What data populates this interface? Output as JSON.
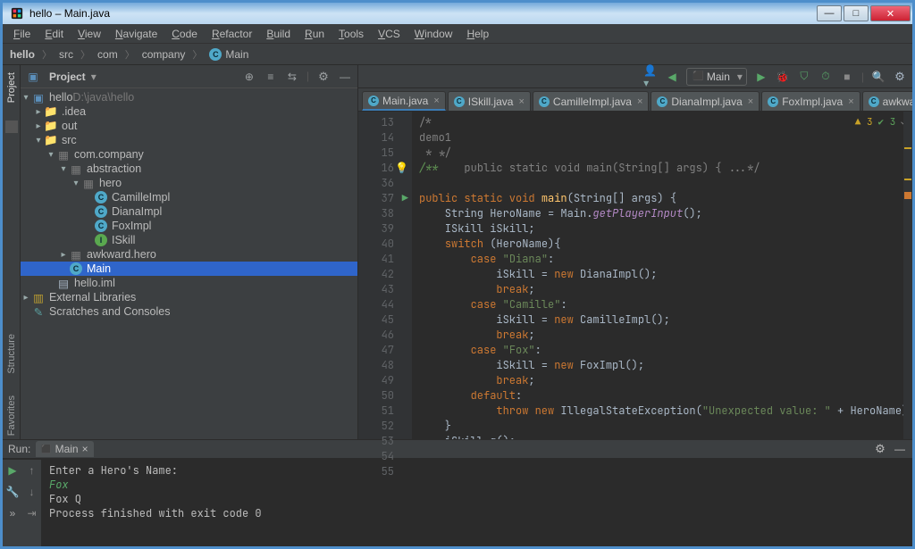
{
  "window": {
    "title": "hello – Main.java"
  },
  "menu": [
    "File",
    "Edit",
    "View",
    "Navigate",
    "Code",
    "Refactor",
    "Build",
    "Run",
    "Tools",
    "VCS",
    "Window",
    "Help"
  ],
  "breadcrumbs": [
    "hello",
    "src",
    "com",
    "company",
    "Main"
  ],
  "project_panel": {
    "title": "Project",
    "path_hint": "D:\\java\\hello",
    "tree": [
      {
        "d": 0,
        "c": "▾",
        "icon": "module",
        "label": "hello",
        "dim": "D:\\java\\hello"
      },
      {
        "d": 1,
        "c": "▸",
        "icon": "folder",
        "label": ".idea"
      },
      {
        "d": 1,
        "c": "▸",
        "icon": "folder-out",
        "label": "out"
      },
      {
        "d": 1,
        "c": "▾",
        "icon": "folder-src",
        "label": "src"
      },
      {
        "d": 2,
        "c": "▾",
        "icon": "pkg",
        "label": "com.company"
      },
      {
        "d": 3,
        "c": "▾",
        "icon": "pkg",
        "label": "abstraction"
      },
      {
        "d": 4,
        "c": "▾",
        "icon": "pkg",
        "label": "hero"
      },
      {
        "d": 5,
        "c": " ",
        "icon": "class",
        "label": "CamilleImpl"
      },
      {
        "d": 5,
        "c": " ",
        "icon": "class",
        "label": "DianaImpl"
      },
      {
        "d": 5,
        "c": " ",
        "icon": "class",
        "label": "FoxImpl"
      },
      {
        "d": 5,
        "c": " ",
        "icon": "iface",
        "label": "ISkill"
      },
      {
        "d": 3,
        "c": "▸",
        "icon": "pkg",
        "label": "awkward.hero"
      },
      {
        "d": 3,
        "c": " ",
        "icon": "class",
        "label": "Main",
        "selected": true
      },
      {
        "d": 2,
        "c": " ",
        "icon": "file",
        "label": "hello.iml"
      },
      {
        "d": 0,
        "c": "▸",
        "icon": "lib",
        "label": "External Libraries"
      },
      {
        "d": 0,
        "c": " ",
        "icon": "scratch",
        "label": "Scratches and Consoles"
      }
    ]
  },
  "run_config": {
    "name": "Main"
  },
  "editor_tabs": [
    {
      "label": "Main.java",
      "active": true
    },
    {
      "label": "ISkill.java"
    },
    {
      "label": "CamilleImpl.java"
    },
    {
      "label": "DianaImpl.java"
    },
    {
      "label": "FoxImpl.java"
    },
    {
      "label": "awkward\\...\\Fox.jav..."
    }
  ],
  "inspections": {
    "warnings": "3",
    "oks": "3"
  },
  "code": {
    "first_line_no": 13,
    "lines": [
      {
        "n": "13",
        "html": "<span class='cm'>/*</span>"
      },
      {
        "n": "14",
        "html": "<span class='cm'>demo1</span>"
      },
      {
        "n": "15",
        "html": "<span class='cm'> * */</span>"
      },
      {
        "n": "16",
        "bulb": true,
        "html": "<span class='cmgreen'>/**</span>    <span class='cm'>public static void main(String[] args) { ...*/</span>"
      },
      {
        "n": "36",
        "html": ""
      },
      {
        "n": "37",
        "run": true,
        "html": "<span class='kw'>public static void</span> <span class='fn'>main</span>(String[] args) {"
      },
      {
        "n": "38",
        "html": "    String HeroName = Main.<span class='fni'>getPlayerInput</span>();"
      },
      {
        "n": "39",
        "html": "    ISkill iSkill;"
      },
      {
        "n": "40",
        "html": "    <span class='kw'>switch</span> (HeroName){"
      },
      {
        "n": "41",
        "html": "        <span class='kw'>case</span> <span class='str'>\"Diana\"</span>:"
      },
      {
        "n": "42",
        "html": "            iSkill = <span class='kw'>new</span> DianaImpl();"
      },
      {
        "n": "43",
        "html": "            <span class='kw'>break</span>;"
      },
      {
        "n": "44",
        "html": "        <span class='kw'>case</span> <span class='str'>\"Camille\"</span>:"
      },
      {
        "n": "45",
        "html": "            iSkill = <span class='kw'>new</span> CamilleImpl();"
      },
      {
        "n": "46",
        "html": "            <span class='kw'>break</span>;"
      },
      {
        "n": "47",
        "html": "        <span class='kw'>case</span> <span class='str'>\"Fox\"</span>:"
      },
      {
        "n": "48",
        "html": "            iSkill = <span class='kw'>new</span> FoxImpl();"
      },
      {
        "n": "49",
        "html": "            <span class='kw'>break</span>;"
      },
      {
        "n": "50",
        "html": "        <span class='kw'>default</span>:"
      },
      {
        "n": "51",
        "html": "            <span class='kw'>throw new</span> IllegalStateException(<span class='str'>\"Unexpected value: \"</span> + HeroName);"
      },
      {
        "n": "52",
        "html": "    }"
      },
      {
        "n": "53",
        "html": "    iSkill.q();"
      },
      {
        "n": "54",
        "html": ""
      },
      {
        "n": "55",
        "html": "}"
      }
    ]
  },
  "run_panel": {
    "title": "Run:",
    "tab": "Main",
    "lines": [
      {
        "t": "Enter a Hero's Name:",
        "cls": ""
      },
      {
        "t": "Fox",
        "cls": "input"
      },
      {
        "t": "Fox Q",
        "cls": ""
      },
      {
        "t": "",
        "cls": ""
      },
      {
        "t": "Process finished with exit code 0",
        "cls": ""
      }
    ]
  },
  "side_tabs": [
    "Project",
    "Structure",
    "Favorites"
  ]
}
